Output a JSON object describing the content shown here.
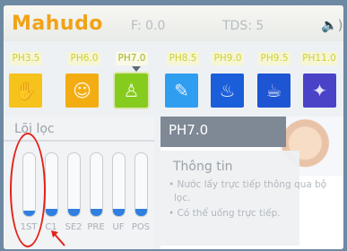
{
  "header": {
    "brand": "Mahudo",
    "f_label": "F: 0.0",
    "tds_label": "TDS: 5",
    "speaker_icon": "speaker-volume-icon"
  },
  "ph_levels": [
    {
      "label": "PH3.5",
      "color": "#f6c21c",
      "icon": "hand-wash-icon"
    },
    {
      "label": "PH6.0",
      "color": "#f3ad12",
      "icon": "face-care-icon"
    },
    {
      "label": "PH7.0",
      "color": "#86cc1f",
      "icon": "baby-icon",
      "selected": true
    },
    {
      "label": "PH8.5",
      "color": "#2f9ef0",
      "icon": "brush-icon"
    },
    {
      "label": "PH9.0",
      "color": "#1a5ed9",
      "icon": "cooking-pot-icon"
    },
    {
      "label": "PH9.5",
      "color": "#1e55d2",
      "icon": "tea-cup-icon"
    },
    {
      "label": "PH11.0",
      "color": "#4a43c8",
      "icon": "cleaning-icon"
    }
  ],
  "filter_panel": {
    "title": "Lõi lọc",
    "filters": [
      {
        "label": "1ST",
        "level": 0.08
      },
      {
        "label": "C1",
        "level": 0.12
      },
      {
        "label": "SE2",
        "level": 0.12
      },
      {
        "label": "PRE",
        "level": 0.12
      },
      {
        "label": "UF",
        "level": 0.12
      },
      {
        "label": "POS",
        "level": 0.12
      }
    ]
  },
  "info_panel": {
    "ph_title": "PH7.0",
    "heading": "Thông tin",
    "line1": "• Nước lấy trực tiếp thông qua bộ",
    "line2": "lọc.",
    "line3": "• Có thể uống trực tiếp."
  },
  "colors": {
    "accent": "#f0a318",
    "filter_fill": "#2e7fe0",
    "annotation": "#e2231a"
  }
}
